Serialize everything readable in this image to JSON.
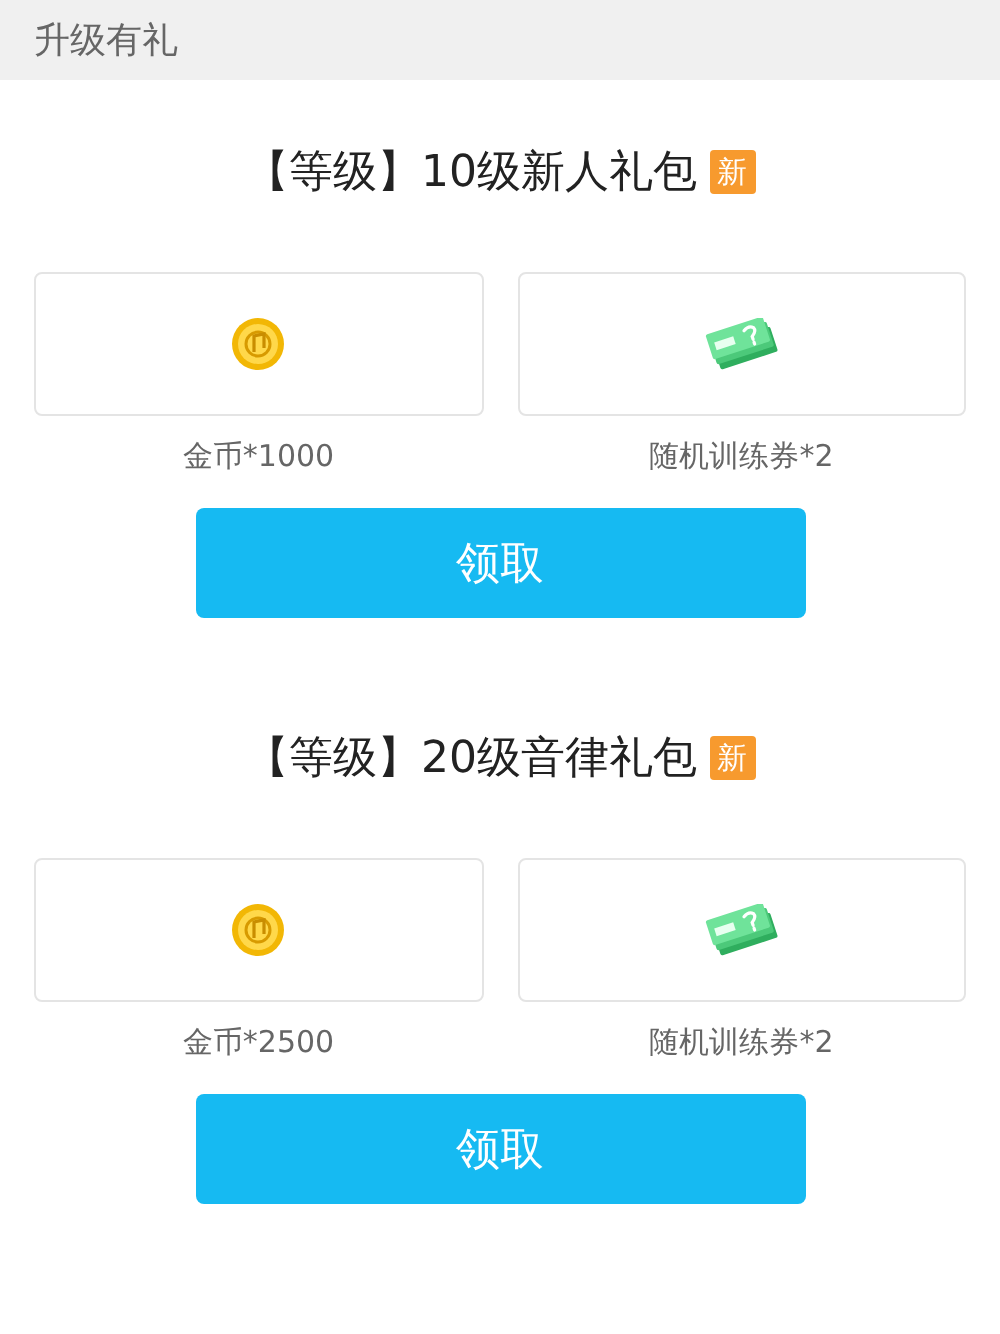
{
  "header": {
    "title": "升级有礼"
  },
  "packages": [
    {
      "title": "【等级】10级新人礼包",
      "badge": "新",
      "items": [
        {
          "kind": "coin",
          "label": "金币*1000"
        },
        {
          "kind": "ticket",
          "label": "随机训练券*2"
        }
      ],
      "button": "领取"
    },
    {
      "title": "【等级】20级音律礼包",
      "badge": "新",
      "items": [
        {
          "kind": "coin",
          "label": "金币*2500"
        },
        {
          "kind": "ticket",
          "label": "随机训练券*2"
        }
      ],
      "button": "领取"
    }
  ]
}
